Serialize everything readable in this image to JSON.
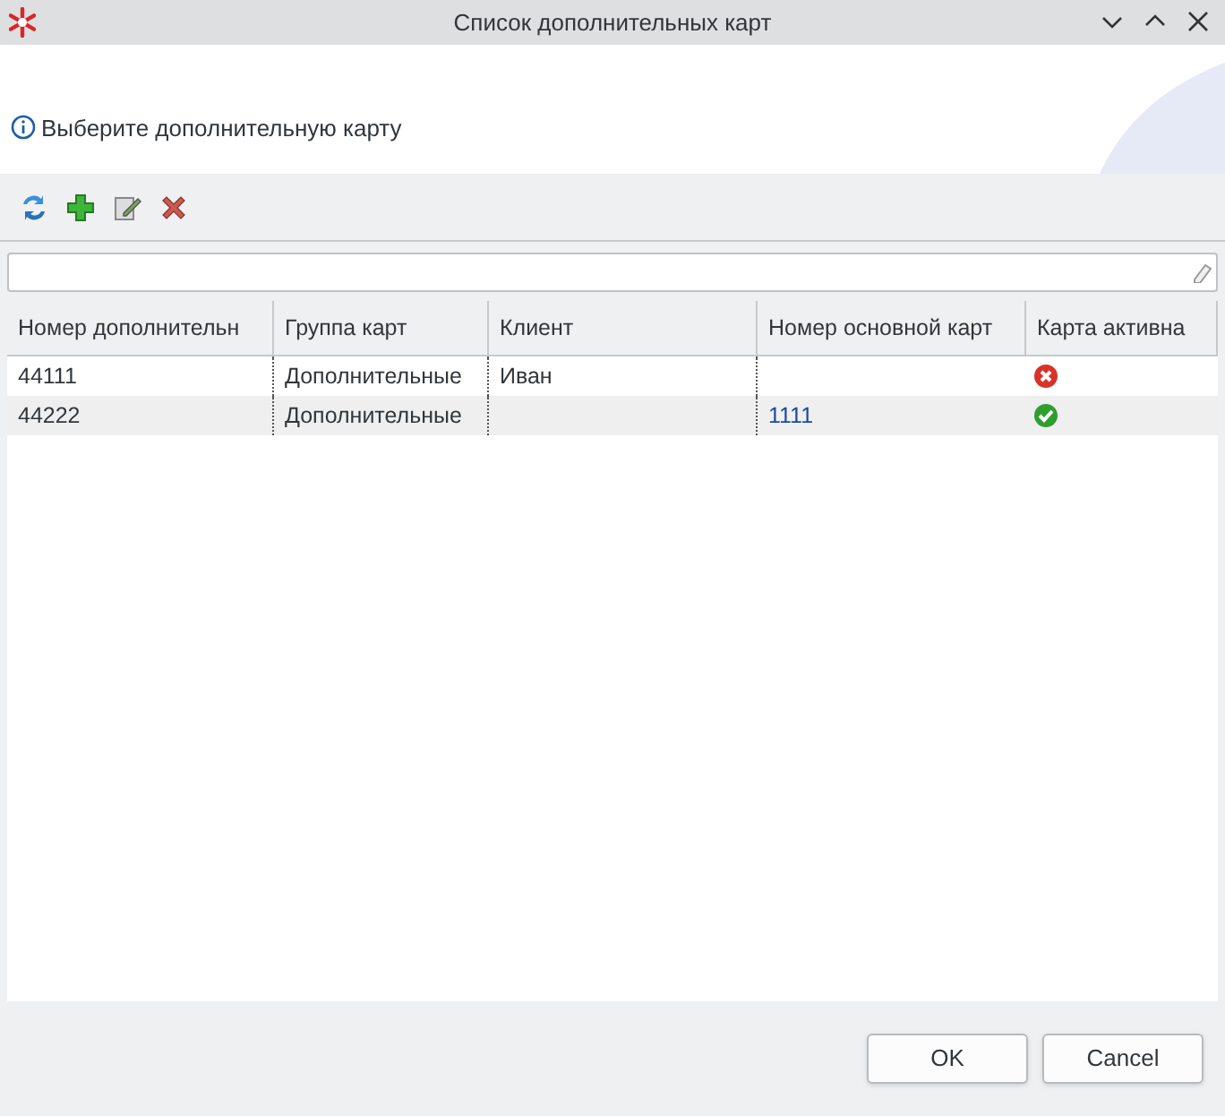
{
  "window": {
    "title": "Список дополнительных карт"
  },
  "banner": {
    "message": "Выберите дополнительную карту"
  },
  "toolbar": [
    {
      "kind": "refresh"
    },
    {
      "kind": "add"
    },
    {
      "kind": "edit"
    },
    {
      "kind": "delete"
    }
  ],
  "table": {
    "columns": [
      "Номер дополнительн",
      "Группа карт",
      "Клиент",
      "Номер основной карт",
      "Карта активна"
    ],
    "rows": [
      {
        "number": "44111",
        "group": "Дополнительные",
        "client": "Иван",
        "main_card": "",
        "active": false
      },
      {
        "number": "44222",
        "group": "Дополнительные",
        "client": "",
        "main_card": "1111",
        "active": true
      }
    ]
  },
  "buttons": [
    "OK",
    "Cancel"
  ]
}
